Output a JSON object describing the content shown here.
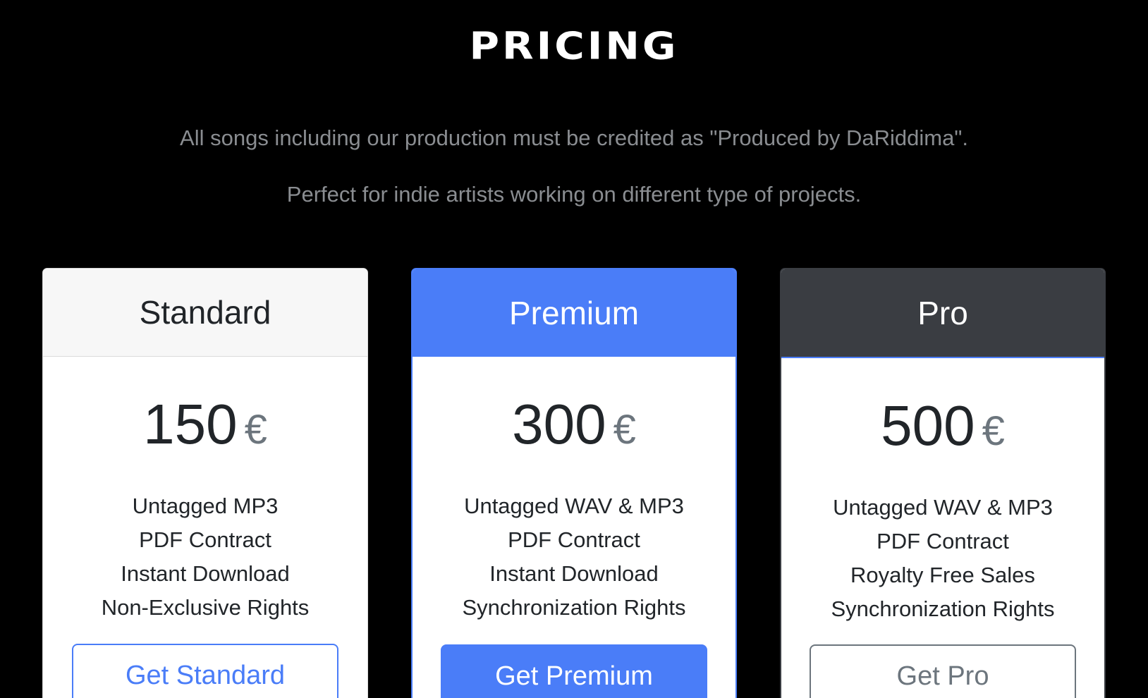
{
  "header": {
    "title": "PRICING",
    "line1": "All songs including our production must be credited as \"Produced by DaRiddima\".",
    "line2": "Perfect for indie artists working on different type of projects."
  },
  "plans": [
    {
      "name": "Standard",
      "price": "150",
      "currency": "€",
      "features": [
        "Untagged MP3",
        "PDF Contract",
        "Instant Download",
        "Non-Exclusive Rights"
      ],
      "button": "Get Standard"
    },
    {
      "name": "Premium",
      "price": "300",
      "currency": "€",
      "features": [
        "Untagged WAV & MP3",
        "PDF Contract",
        "Instant Download",
        "Synchronization Rights"
      ],
      "button": "Get Premium"
    },
    {
      "name": "Pro",
      "price": "500",
      "currency": "€",
      "features": [
        "Untagged WAV & MP3",
        "PDF Contract",
        "Royalty Free Sales",
        "Synchronization Rights"
      ],
      "button": "Get Pro"
    }
  ],
  "colors": {
    "background": "#000000",
    "accent": "#4a7df8",
    "pro_header": "#3a3d42",
    "muted_text": "#8a8d91"
  }
}
